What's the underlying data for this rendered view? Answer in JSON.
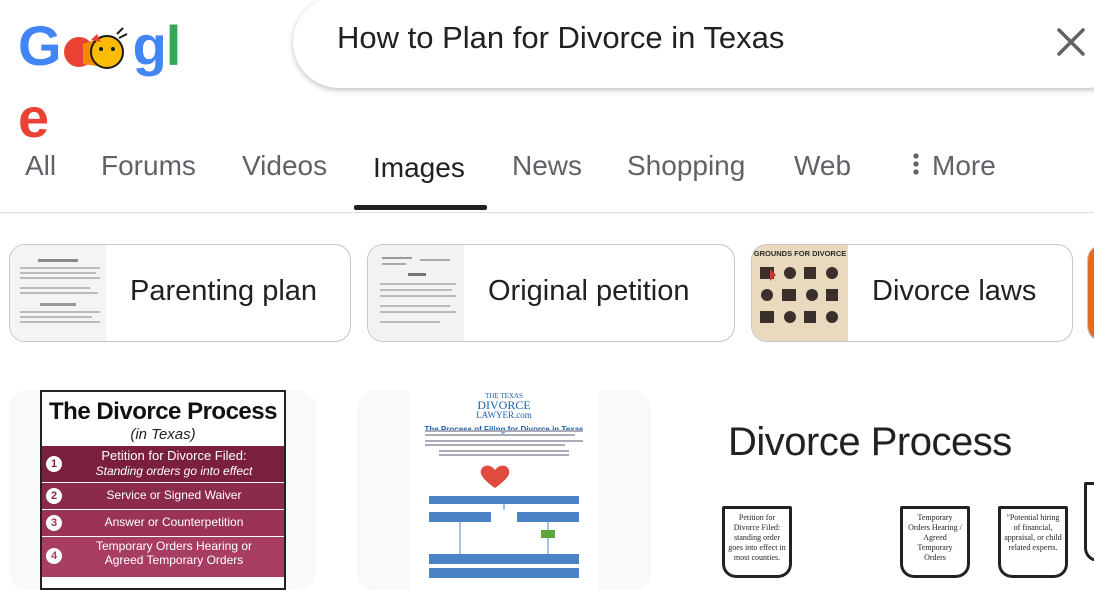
{
  "logo": {
    "letters": [
      "G",
      "o",
      "o",
      "g",
      "l",
      "e"
    ]
  },
  "search": {
    "query": "How to Plan for Divorce in Texas"
  },
  "tabs": [
    {
      "label": "All"
    },
    {
      "label": "Forums"
    },
    {
      "label": "Videos"
    },
    {
      "label": "Images"
    },
    {
      "label": "News"
    },
    {
      "label": "Shopping"
    },
    {
      "label": "Web"
    },
    {
      "label": "More"
    }
  ],
  "chips": [
    {
      "label": "Parenting plan"
    },
    {
      "label": "Original petition"
    },
    {
      "label": "Divorce laws"
    }
  ],
  "chip_thumbs": {
    "divorce_laws_header": "GROUNDS FOR DIVORCE"
  },
  "results": [
    {
      "title": "The Divorce Process",
      "subtitle": "(in Texas)",
      "steps": [
        {
          "title": "Petition for Divorce Filed:",
          "sub": "Standing orders go into effect"
        },
        {
          "title": "Service or Signed Waiver"
        },
        {
          "title": "Answer or Counterpetition"
        },
        {
          "title": "Temporary Orders Hearing or",
          "sub": "Agreed Temporary Orders"
        }
      ]
    },
    {
      "brand_line1": "THE TEXAS",
      "brand_line2": "DIVORCE",
      "brand_line3": "LAWYER.com",
      "title": "The Process of Filing for Divorce in Texas"
    },
    {
      "title": "Divorce Process",
      "boxes": [
        "Petition for Divorce Filed: standing order goes into effect in most counties.",
        "Temporary Orders Hearing / Agreed Temporary Orders",
        "\"Potential hiring of financial, appraisal, or child related experts."
      ]
    }
  ],
  "colors": {
    "tab_active": "#202124",
    "tab_inactive": "#5f6368",
    "infographic_maroon": "#7a1f3d"
  }
}
